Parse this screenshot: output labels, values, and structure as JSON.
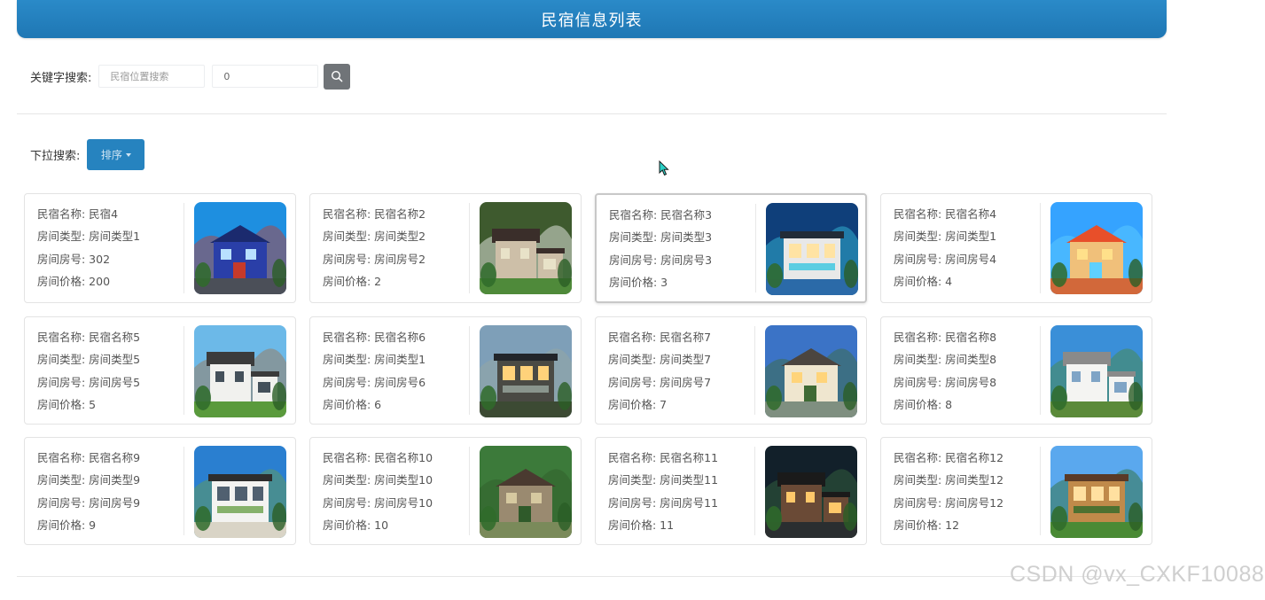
{
  "header": {
    "title": "民宿信息列表"
  },
  "search": {
    "label": "关键字搜索:",
    "keyword_placeholder": "民宿位置搜索",
    "number_value": "0"
  },
  "dropdown": {
    "label": "下拉搜索:",
    "sort_label": "排序"
  },
  "cards": [
    {
      "name_label": "民宿名称: 民宿4",
      "type_label": "房间类型: 房间类型1",
      "room_label": "房间房号: 302",
      "price_label": "房间价格: 200"
    },
    {
      "name_label": "民宿名称: 民宿名称2",
      "type_label": "房间类型: 房间类型2",
      "room_label": "房间房号: 房间房号2",
      "price_label": "房间价格: 2"
    },
    {
      "name_label": "民宿名称: 民宿名称3",
      "type_label": "房间类型: 房间类型3",
      "room_label": "房间房号: 房间房号3",
      "price_label": "房间价格: 3"
    },
    {
      "name_label": "民宿名称: 民宿名称4",
      "type_label": "房间类型: 房间类型1",
      "room_label": "房间房号: 房间房号4",
      "price_label": "房间价格: 4"
    },
    {
      "name_label": "民宿名称: 民宿名称5",
      "type_label": "房间类型: 房间类型5",
      "room_label": "房间房号: 房间房号5",
      "price_label": "房间价格: 5"
    },
    {
      "name_label": "民宿名称: 民宿名称6",
      "type_label": "房间类型: 房间类型1",
      "room_label": "房间房号: 房间房号6",
      "price_label": "房间价格: 6"
    },
    {
      "name_label": "民宿名称: 民宿名称7",
      "type_label": "房间类型: 房间类型7",
      "room_label": "房间房号: 房间房号7",
      "price_label": "房间价格: 7"
    },
    {
      "name_label": "民宿名称: 民宿名称8",
      "type_label": "房间类型: 房间类型8",
      "room_label": "房间房号: 房间房号8",
      "price_label": "房间价格: 8"
    },
    {
      "name_label": "民宿名称: 民宿名称9",
      "type_label": "房间类型: 房间类型9",
      "room_label": "房间房号: 房间房号9",
      "price_label": "房间价格: 9"
    },
    {
      "name_label": "民宿名称: 民宿名称10",
      "type_label": "房间类型: 房间类型10",
      "room_label": "房间房号: 房间房号10",
      "price_label": "房间价格: 10"
    },
    {
      "name_label": "民宿名称: 民宿名称11",
      "type_label": "房间类型: 房间类型11",
      "room_label": "房间房号: 房间房号11",
      "price_label": "房间价格: 11"
    },
    {
      "name_label": "民宿名称: 民宿名称12",
      "type_label": "房间类型: 房间类型12",
      "room_label": "房间房号: 房间房号12",
      "price_label": "房间价格: 12"
    }
  ],
  "watermark": "CSDN @vx_CXKF10088",
  "icons": {
    "search": "search-icon",
    "caret": "caret-down-icon",
    "cursor": "mouse-cursor-icon"
  },
  "colors": {
    "header": "#1f77b4",
    "sort_button": "#2683bf",
    "search_button": "#707478"
  }
}
